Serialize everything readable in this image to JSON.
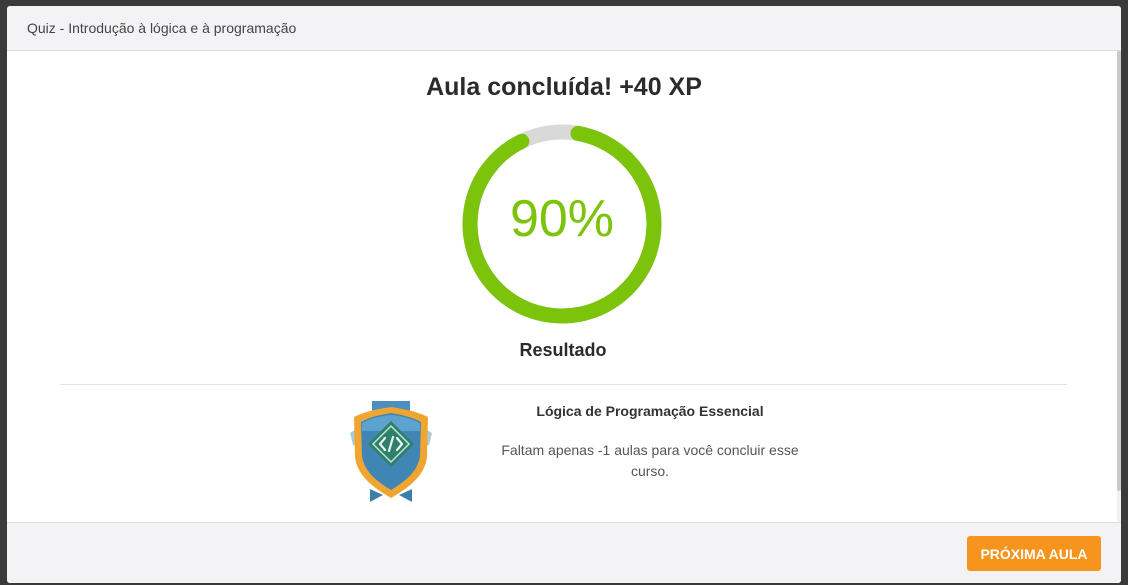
{
  "header": {
    "title": "Quiz - Introdução à lógica e à programação"
  },
  "result": {
    "heading": "Aula concluída! +40 XP",
    "percent_text": "90%",
    "percent_value": 0.9,
    "label": "Resultado",
    "colors": {
      "progress": "#7cc30b",
      "track": "#d9d9d9"
    }
  },
  "course": {
    "badge_icon": "code-shield-badge-icon",
    "title": "Lógica de Programação Essencial",
    "message": "Faltam apenas -1 aulas para você concluir esse curso."
  },
  "footer": {
    "next_label": "PRÓXIMA AULA",
    "accent_color": "#f7941d"
  }
}
